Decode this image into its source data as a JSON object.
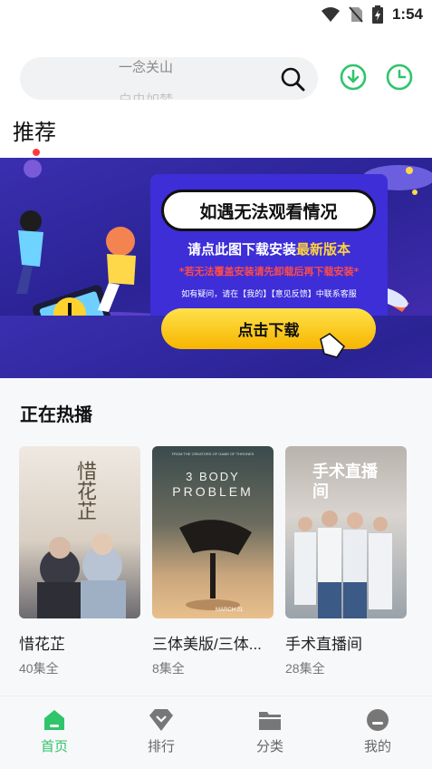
{
  "status_bar": {
    "time": "1:54"
  },
  "search": {
    "hint_current": "一念关山",
    "hint_next": "白虫如梦"
  },
  "header": {
    "section_tab": "推荐"
  },
  "banner": {
    "title": "如遇无法观看情况",
    "line1_prefix": "请点此图下载安装",
    "line1_highlight": "最新版本",
    "line2": "*若无法覆盖安装请先卸载后再下载安装*",
    "line3": "如有疑问，请在【我的】【意见反馈】中联系客服",
    "button": "点击下载"
  },
  "hot": {
    "title": "正在热播",
    "items": [
      {
        "name": "惜花芷",
        "episodes": "40集全"
      },
      {
        "name": "三体美版/三体...",
        "episodes": "8集全"
      },
      {
        "name": "手术直播间",
        "episodes": "28集全"
      }
    ]
  },
  "posters": {
    "p1_title": "惜花芷",
    "p2_title_top": "3 BODY",
    "p2_title_bottom": "PROBLEM",
    "p2_tagline": "FROM THE CREATORS OF GAME OF THRONES",
    "p2_date": "MARCH 21",
    "p3_title": "手术直播间"
  },
  "nav": {
    "items": [
      {
        "label": "首页",
        "icon": "home-icon"
      },
      {
        "label": "排行",
        "icon": "ranking-icon"
      },
      {
        "label": "分类",
        "icon": "folder-icon"
      },
      {
        "label": "我的",
        "icon": "profile-icon"
      }
    ]
  },
  "colors": {
    "accent": "#2fc56b",
    "banner_button": "#f7b500",
    "tab_dot": "#ff3b3b"
  }
}
